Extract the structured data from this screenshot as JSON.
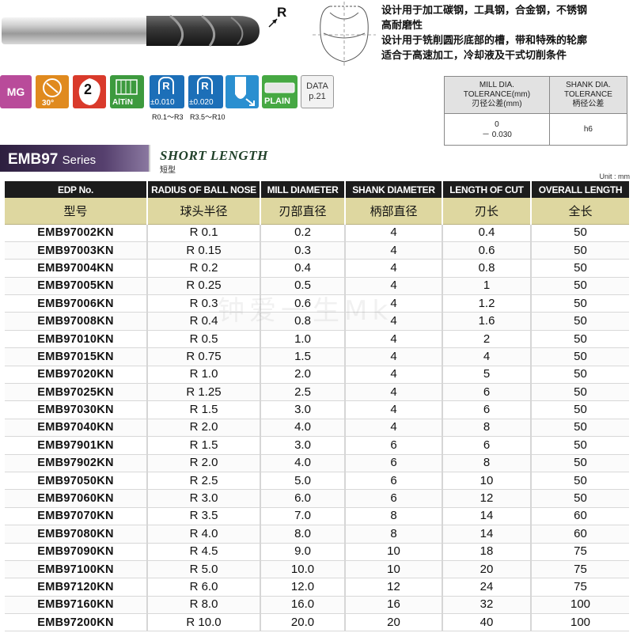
{
  "header": {
    "radius_label": "R",
    "features": [
      "设计用于加工碳钢，工具钢，合金钢，不锈钢",
      "高耐磨性",
      "设计用于铣削圆形底部的槽，带和特殊的轮廓",
      "适合于高速加工，冷却液及干式切削条件"
    ]
  },
  "icons": {
    "material": "MG",
    "helix": "30°",
    "flutes": "2",
    "coating": "AlTiN",
    "radius_tol_1": {
      "letter": "R",
      "tolerance": "±0.010",
      "range": "R0.1～R3"
    },
    "radius_tol_2": {
      "letter": "R",
      "tolerance": "±0.020",
      "range": "R3.5～R10"
    },
    "shank": "PLAIN",
    "data_ref": {
      "line1": "DATA",
      "line2": "p.21"
    }
  },
  "tolerance": {
    "mill_head": [
      "MILL DIA.",
      "TOLERANCE(mm)",
      "刃径公差(mm)"
    ],
    "shank_head": [
      "SHANK DIA.",
      "TOLERANCE",
      "柄径公差"
    ],
    "mill_value": [
      "0",
      "－ 0.030"
    ],
    "shank_value": "h6"
  },
  "series": {
    "name": "EMB97",
    "suffix": "Series",
    "length_en": "SHORT LENGTH",
    "length_cn": "短型",
    "unit": "Unit : mm"
  },
  "watermark": "钟爱一生Mk",
  "table": {
    "headers_en": [
      "EDP No.",
      "RADIUS OF BALL NOSE",
      "MILL DIAMETER",
      "SHANK DIAMETER",
      "LENGTH OF CUT",
      "OVERALL LENGTH"
    ],
    "headers_cn": [
      "型号",
      "球头半径",
      "刃部直径",
      "柄部直径",
      "刃长",
      "全长"
    ],
    "rows": [
      [
        "EMB97002KN",
        "R 0.1",
        "0.2",
        "4",
        "0.4",
        "50"
      ],
      [
        "EMB97003KN",
        "R 0.15",
        "0.3",
        "4",
        "0.6",
        "50"
      ],
      [
        "EMB97004KN",
        "R 0.2",
        "0.4",
        "4",
        "0.8",
        "50"
      ],
      [
        "EMB97005KN",
        "R 0.25",
        "0.5",
        "4",
        "1",
        "50"
      ],
      [
        "EMB97006KN",
        "R 0.3",
        "0.6",
        "4",
        "1.2",
        "50"
      ],
      [
        "EMB97008KN",
        "R 0.4",
        "0.8",
        "4",
        "1.6",
        "50"
      ],
      [
        "EMB97010KN",
        "R 0.5",
        "1.0",
        "4",
        "2",
        "50"
      ],
      [
        "EMB97015KN",
        "R 0.75",
        "1.5",
        "4",
        "4",
        "50"
      ],
      [
        "EMB97020KN",
        "R 1.0",
        "2.0",
        "4",
        "5",
        "50"
      ],
      [
        "EMB97025KN",
        "R 1.25",
        "2.5",
        "4",
        "6",
        "50"
      ],
      [
        "EMB97030KN",
        "R 1.5",
        "3.0",
        "4",
        "6",
        "50"
      ],
      [
        "EMB97040KN",
        "R 2.0",
        "4.0",
        "4",
        "8",
        "50"
      ],
      [
        "EMB97901KN",
        "R 1.5",
        "3.0",
        "6",
        "6",
        "50"
      ],
      [
        "EMB97902KN",
        "R 2.0",
        "4.0",
        "6",
        "8",
        "50"
      ],
      [
        "EMB97050KN",
        "R 2.5",
        "5.0",
        "6",
        "10",
        "50"
      ],
      [
        "EMB97060KN",
        "R 3.0",
        "6.0",
        "6",
        "12",
        "50"
      ],
      [
        "EMB97070KN",
        "R 3.5",
        "7.0",
        "8",
        "14",
        "60"
      ],
      [
        "EMB97080KN",
        "R 4.0",
        "8.0",
        "8",
        "14",
        "60"
      ],
      [
        "EMB97090KN",
        "R 4.5",
        "9.0",
        "10",
        "18",
        "75"
      ],
      [
        "EMB97100KN",
        "R 5.0",
        "10.0",
        "10",
        "20",
        "75"
      ],
      [
        "EMB97120KN",
        "R 6.0",
        "12.0",
        "12",
        "24",
        "75"
      ],
      [
        "EMB97160KN",
        "R 8.0",
        "16.0",
        "16",
        "32",
        "100"
      ],
      [
        "EMB97200KN",
        "R 10.0",
        "20.0",
        "20",
        "40",
        "100"
      ]
    ]
  }
}
